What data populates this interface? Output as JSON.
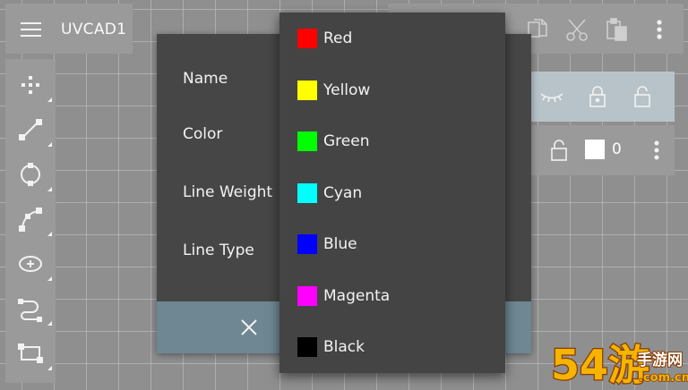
{
  "app": {
    "title": "UVCAD1"
  },
  "toolbar": {
    "tools": [
      {
        "icon": "point-tool-icon"
      },
      {
        "icon": "line-tool-icon"
      },
      {
        "icon": "circle-tool-icon"
      },
      {
        "icon": "arc-tool-icon"
      },
      {
        "icon": "ellipse-tool-icon"
      },
      {
        "icon": "polyline-tool-icon"
      },
      {
        "icon": "rectangle-tool-icon"
      }
    ]
  },
  "top_actions": [
    "copy-icon",
    "cut-icon",
    "paste-icon",
    "more-vert-icon"
  ],
  "layer_panel": {
    "header_icons": [
      "visibility-icon",
      "lock-icon",
      "unlock-icon"
    ],
    "row": {
      "index": "0",
      "swatch_color": "#ffffff"
    }
  },
  "dialog": {
    "fields": {
      "name": "Name",
      "color": "Color",
      "line_weight": "Line Weight",
      "line_type": "Line Type"
    }
  },
  "color_menu": {
    "items": [
      {
        "label": "Red",
        "color": "#ff0000"
      },
      {
        "label": "Yellow",
        "color": "#ffff00"
      },
      {
        "label": "Green",
        "color": "#00ff00"
      },
      {
        "label": "Cyan",
        "color": "#00ffff"
      },
      {
        "label": "Blue",
        "color": "#0000ff"
      },
      {
        "label": "Magenta",
        "color": "#ff00ff"
      },
      {
        "label": "Black",
        "color": "#000000"
      }
    ]
  },
  "watermark": {
    "text": "54游",
    "subtext": "手游网",
    "domain": ".com.cn"
  }
}
